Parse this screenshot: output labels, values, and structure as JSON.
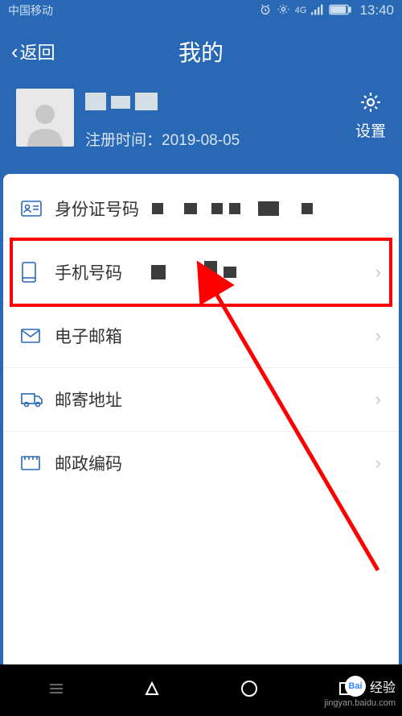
{
  "status": {
    "carrier": "中国移动",
    "network": "4G",
    "time": "13:40"
  },
  "header": {
    "back_label": "返回",
    "title": "我的"
  },
  "profile": {
    "register_label": "注册时间：",
    "register_date": "2019-08-05",
    "settings_label": "设置"
  },
  "list": {
    "id_card_label": "身份证号码",
    "phone_label": "手机号码",
    "email_label": "电子邮箱",
    "address_label": "邮寄地址",
    "postcode_label": "邮政编码"
  },
  "watermark": {
    "logo_text": "Bai",
    "main": "经验",
    "sub": "jingyan.baidu.com"
  }
}
